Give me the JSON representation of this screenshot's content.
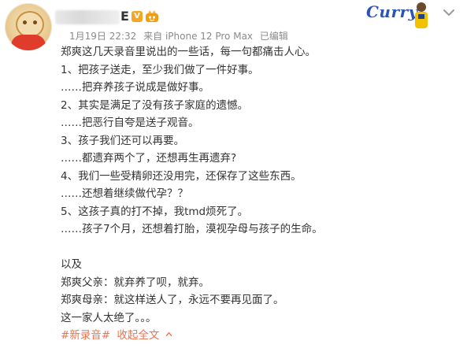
{
  "header": {
    "username_suffix": "E",
    "verified_badge": "V",
    "timestamp": "1月19日 22:32",
    "source": "来自 iPhone 12 Pro Max",
    "edited": "已编辑",
    "avatar_icon": "avatar-cartoon",
    "member_icon": "member-crown-icon"
  },
  "corner": {
    "card_text": "Curry",
    "menu_icon": "chevron-down-icon"
  },
  "post": {
    "lines": [
      "郑爽这几天录音里说出的一些话，每一句都痛击人心。",
      "1、把孩子送走，至少我们做了一件好事。",
      "……把弃养孩子说成是做好事。",
      "2、其实是满足了没有孩子家庭的遗憾。",
      "……把恶行自夸是送子观音。",
      "3、孩子我们还可以再要。",
      "……都遗弃两个了，还想再生再遗弃?",
      "4、我们一些受精卵还没用完，还保存了这些东西。",
      "……还想着继续做代孕？？",
      "5、这孩子真的打不掉，我tmd烦死了。",
      "……孩子7个月，还想着打胎，漠视孕母与孩子的生命。",
      "",
      "以及",
      "郑爽父亲：就弃养了呗，就弃。",
      "郑爽母亲：就这样送人了，永远不要再见面了。",
      "这一家人太绝了。。。"
    ],
    "hashtag": "#新录音#",
    "collapse_label": "收起全文"
  },
  "colors": {
    "link": "#eb7350",
    "meta": "#8a8a8a",
    "text": "#333333",
    "curry_blue": "#2a55b5"
  }
}
